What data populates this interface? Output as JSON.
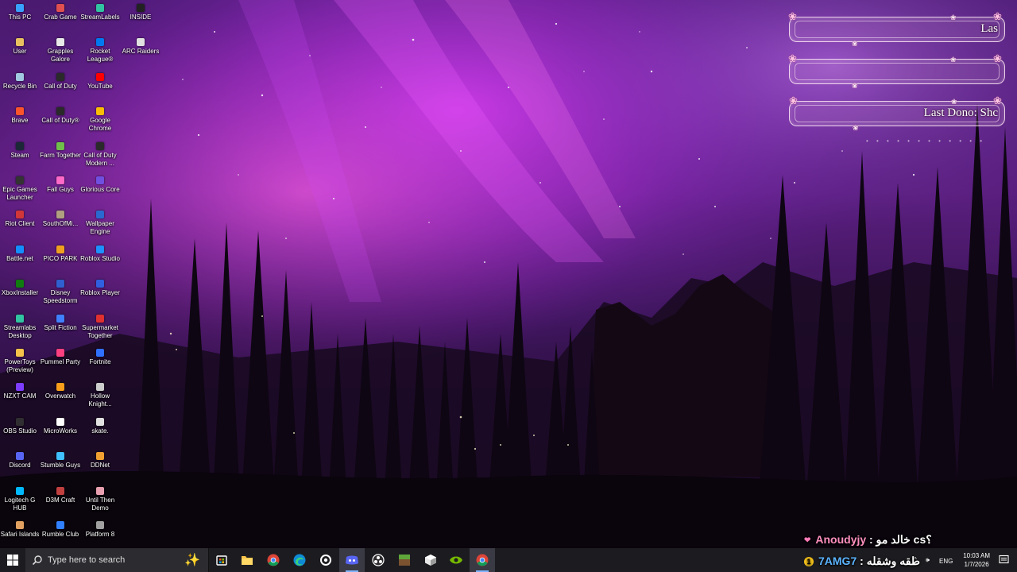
{
  "desktop": {
    "icons": [
      {
        "label": "This PC",
        "color": "#3aa0ff"
      },
      {
        "label": "User",
        "color": "#e8c060"
      },
      {
        "label": "Recycle Bin",
        "color": "#a0c8e0"
      },
      {
        "label": "Brave",
        "color": "#fb542b"
      },
      {
        "label": "Steam",
        "color": "#1b2838"
      },
      {
        "label": "Epic Games Launcher",
        "color": "#333333"
      },
      {
        "label": "Riot Client",
        "color": "#d13639"
      },
      {
        "label": "Battle.net",
        "color": "#148eff"
      },
      {
        "label": "XboxInstaller",
        "color": "#107c10"
      },
      {
        "label": "Streamlabs Desktop",
        "color": "#31c3a2"
      },
      {
        "label": "PowerToys (Preview)",
        "color": "#f5c24a"
      },
      {
        "label": "NZXT CAM",
        "color": "#7d3cff"
      },
      {
        "label": "OBS Studio",
        "color": "#302e31"
      },
      {
        "label": "Discord",
        "color": "#5865f2"
      },
      {
        "label": "Logitech G HUB",
        "color": "#00b8fc"
      },
      {
        "label": "Safari Islands",
        "color": "#e0a060"
      },
      {
        "label": "Crab Game",
        "color": "#e05050"
      },
      {
        "label": "Grapples Galore",
        "color": "#e8e8e8"
      },
      {
        "label": "Call of Duty",
        "color": "#2a2a2a"
      },
      {
        "label": "Call of Duty®",
        "color": "#2a2a2a"
      },
      {
        "label": "Farm Together",
        "color": "#6fbf4a"
      },
      {
        "label": "Fall Guys",
        "color": "#ff69c8"
      },
      {
        "label": "SouthOfMi...",
        "color": "#b0a080"
      },
      {
        "label": "PICO PARK",
        "color": "#f0a020"
      },
      {
        "label": "Disney Speedstorm",
        "color": "#3060d0"
      },
      {
        "label": "Split Fiction",
        "color": "#4080ff"
      },
      {
        "label": "Pummel Party",
        "color": "#ff4080"
      },
      {
        "label": "Overwatch",
        "color": "#f99e1a"
      },
      {
        "label": "MicroWorks",
        "color": "#ffffff"
      },
      {
        "label": "Stumble Guys",
        "color": "#40c0ff"
      },
      {
        "label": "D3M Craft",
        "color": "#c04040"
      },
      {
        "label": "Rumble Club",
        "color": "#3080ff"
      },
      {
        "label": "StreamLabels",
        "color": "#31c3a2"
      },
      {
        "label": "Rocket League®",
        "color": "#0078f0"
      },
      {
        "label": "YouTube",
        "color": "#ff0000"
      },
      {
        "label": "Google Chrome",
        "color": "#fbbc05"
      },
      {
        "label": "Call of Duty Modern ...",
        "color": "#2a2a2a"
      },
      {
        "label": "Glorious Core",
        "color": "#7050e0"
      },
      {
        "label": "Wallpaper Engine",
        "color": "#2a6ad0"
      },
      {
        "label": "Roblox Studio",
        "color": "#1e90ff"
      },
      {
        "label": "Roblox Player",
        "color": "#3060e0"
      },
      {
        "label": "Supermarket Together",
        "color": "#e03030"
      },
      {
        "label": "Fortnite",
        "color": "#3070ff"
      },
      {
        "label": "Hollow Knight...",
        "color": "#cccccc"
      },
      {
        "label": "skate.",
        "color": "#e0e0e0"
      },
      {
        "label": "DDNet",
        "color": "#f0a030"
      },
      {
        "label": "Until Then Demo",
        "color": "#e8a0b0"
      },
      {
        "label": "Platform 8",
        "color": "#a0a0a0"
      },
      {
        "label": "INSIDE",
        "color": "#222222"
      },
      {
        "label": "ARC Raiders",
        "color": "#e0e0e0"
      }
    ]
  },
  "overlay": {
    "bar1_text": "Las",
    "bar2_text": "",
    "bar3_text": "Last Dono: Shc",
    "flower_glyph": "❀"
  },
  "chat": {
    "line1": {
      "user": "Anoudyjy",
      "sep": " : ",
      "message": "خالد مو cs؟"
    },
    "line2": {
      "badge": "1",
      "user": "7AMG7",
      "sep": " : ",
      "message": "طقه وشقله"
    }
  },
  "taskbar": {
    "start_icon": "windows-logo",
    "search_placeholder": "Type here to search",
    "pinned": [
      {
        "name": "task-view-icon"
      },
      {
        "name": "file-explorer-icon"
      },
      {
        "name": "chrome-icon"
      },
      {
        "name": "edge-icon"
      },
      {
        "name": "steam-icon"
      },
      {
        "name": "discord-icon"
      },
      {
        "name": "obs-icon"
      },
      {
        "name": "minecraft-icon"
      },
      {
        "name": "cube-app-icon"
      },
      {
        "name": "nvidia-icon"
      },
      {
        "name": "chrome-profile-icon"
      }
    ],
    "language": "ENG",
    "time": "10:03 AM",
    "date": "1/7/2026"
  }
}
